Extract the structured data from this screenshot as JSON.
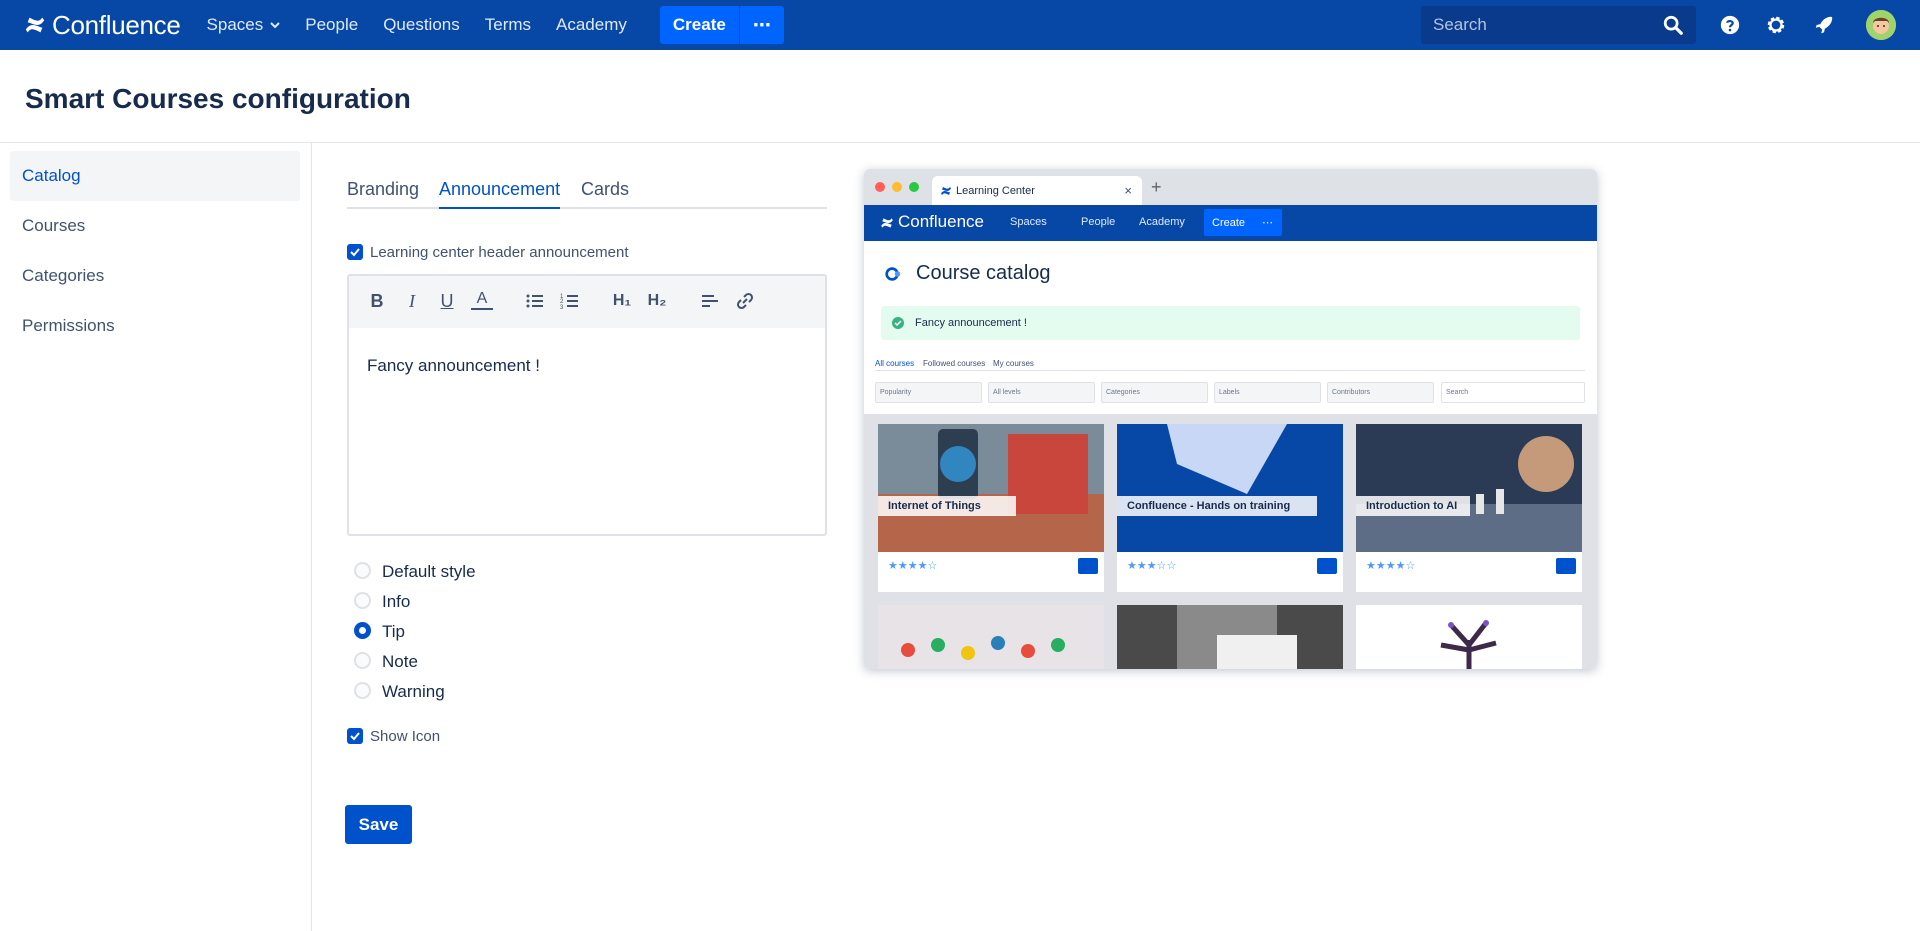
{
  "nav": {
    "logo": "Confluence",
    "spaces": "Spaces",
    "people": "People",
    "questions": "Questions",
    "terms": "Terms",
    "academy": "Academy",
    "create": "Create",
    "more": "⋯",
    "search_placeholder": "Search"
  },
  "page_title": "Smart Courses configuration",
  "sidebar": {
    "items": [
      {
        "label": "Catalog",
        "active": true
      },
      {
        "label": "Courses"
      },
      {
        "label": "Categories"
      },
      {
        "label": "Permissions"
      }
    ]
  },
  "tabs": [
    "Branding",
    "Announcement",
    "Cards"
  ],
  "active_tab": "Announcement",
  "form": {
    "header_announcement_label": "Learning center header announcement",
    "header_announcement_checked": true,
    "editor_content": "Fancy announcement !",
    "styles": [
      "Default style",
      "Info",
      "Tip",
      "Note",
      "Warning"
    ],
    "selected_style": "Tip",
    "show_icon_label": "Show Icon",
    "show_icon_checked": true,
    "save": "Save"
  },
  "toolbar": {
    "bold": "B",
    "italic": "I",
    "underline": "U",
    "text_color": "A",
    "h1": "H₁",
    "h2": "H₂"
  },
  "preview": {
    "browser_tab": "Learning Center",
    "tab_close": "×",
    "new_tab": "+",
    "logo": "Confluence",
    "nav_spaces": "Spaces",
    "nav_people": "People",
    "nav_academy": "Academy",
    "nav_create": "Create",
    "nav_more": "⋯",
    "title": "Course catalog",
    "announcement": "Fancy announcement !",
    "subtabs": [
      "All courses",
      "Followed courses",
      "My courses"
    ],
    "filters": [
      "Popularity",
      "All levels",
      "Categories",
      "Labels",
      "Contributors",
      "Search"
    ],
    "cards": [
      {
        "title": "Internet of Things",
        "rating": "★★★★☆"
      },
      {
        "title": "Confluence - Hands on training",
        "rating": "★★★☆☆"
      },
      {
        "title": "Introduction to AI",
        "rating": "★★★★☆"
      }
    ],
    "colors": {
      "nav": "#0747a6",
      "announcement_bg": "#e3fcef",
      "tip_icon": "#36b37e"
    }
  },
  "colors": {
    "brand": "#0747a6",
    "accent": "#0052cc",
    "button": "#0065ff"
  }
}
